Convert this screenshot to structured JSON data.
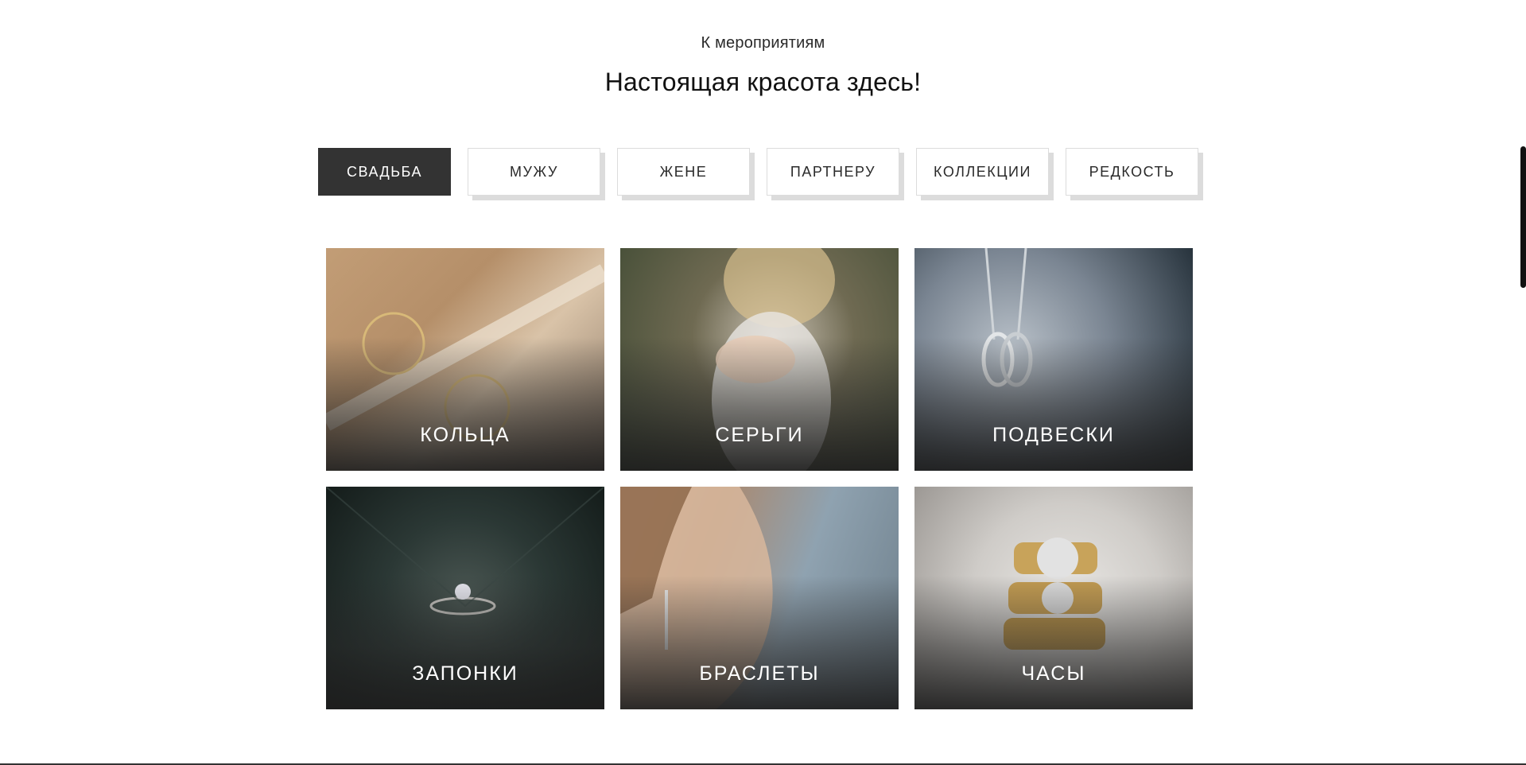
{
  "header": {
    "subtitle": "К мероприятиям",
    "title": "Настоящая красота здесь!"
  },
  "tabs": [
    {
      "label": "СВАДЬБА",
      "active": true
    },
    {
      "label": "МУЖУ",
      "active": false
    },
    {
      "label": "ЖЕНЕ",
      "active": false
    },
    {
      "label": "ПАРТНЕРУ",
      "active": false
    },
    {
      "label": "КОЛЛЕКЦИИ",
      "active": false
    },
    {
      "label": "РЕДКОСТЬ",
      "active": false
    }
  ],
  "categories": [
    {
      "label": "КОЛЬЦА"
    },
    {
      "label": "СЕРЬГИ"
    },
    {
      "label": "ПОДВЕСКИ"
    },
    {
      "label": "ЗАПОНКИ"
    },
    {
      "label": "БРАСЛЕТЫ"
    },
    {
      "label": "ЧАСЫ"
    }
  ],
  "colors": {
    "active_tab": "#333333",
    "tab_shadow": "#dcdcdc",
    "text": "#1a1a1a"
  }
}
